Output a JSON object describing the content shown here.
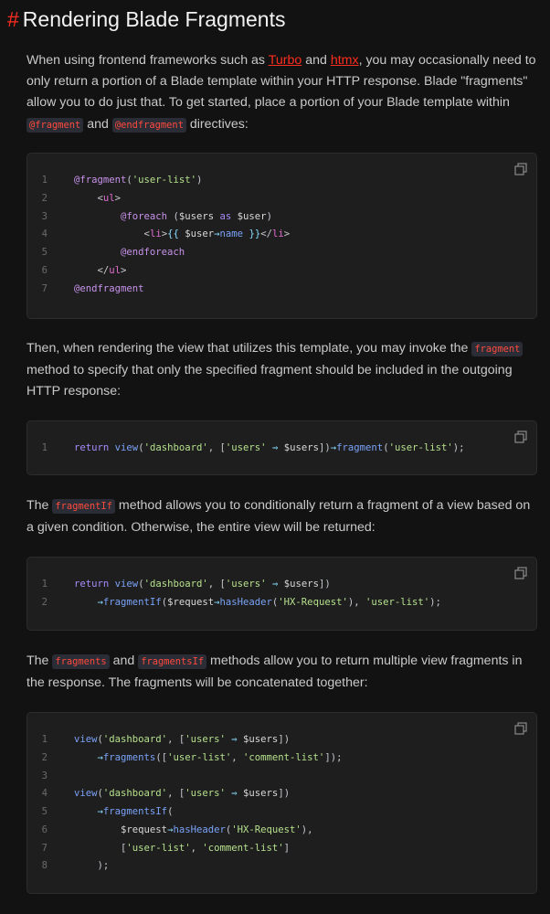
{
  "heading": {
    "hash": "#",
    "title": "Rendering Blade Fragments"
  },
  "para1": {
    "t1": "When using frontend frameworks such as ",
    "link1": "Turbo",
    "t2": " and ",
    "link2": "htmx",
    "t3": ", you may occasionally need to only return a portion of a Blade template within your HTTP response. Blade \"fragments\" allow you to do just that. To get started, place a portion of your Blade template within ",
    "code1": "@fragment",
    "t4": " and ",
    "code2": "@endfragment",
    "t5": " directives:"
  },
  "code1": {
    "lines": [
      {
        "n": "1",
        "text": "@fragment('user-list')"
      },
      {
        "n": "2",
        "text": "    <ul>"
      },
      {
        "n": "3",
        "text": "        @foreach ($users as $user)"
      },
      {
        "n": "4",
        "text": "            <li>{{ $user→name }}</li>"
      },
      {
        "n": "5",
        "text": "        @endforeach"
      },
      {
        "n": "6",
        "text": "    </ul>"
      },
      {
        "n": "7",
        "text": "@endfragment"
      }
    ]
  },
  "para2": {
    "t1": "Then, when rendering the view that utilizes this template, you may invoke the ",
    "code1": "fragment",
    "t2": " method to specify that only the specified fragment should be included in the outgoing HTTP response:"
  },
  "code2": {
    "lines": [
      {
        "n": "1",
        "text": "return view('dashboard', ['users' ⇒ $users])→fragment('user-list');"
      }
    ]
  },
  "para3": {
    "t1": "The ",
    "code1": "fragmentIf",
    "t2": " method allows you to conditionally return a fragment of a view based on a given condition. Otherwise, the entire view will be returned:"
  },
  "code3": {
    "lines": [
      {
        "n": "1",
        "text": "return view('dashboard', ['users' ⇒ $users])"
      },
      {
        "n": "2",
        "text": "    →fragmentIf($request→hasHeader('HX-Request'), 'user-list');"
      }
    ]
  },
  "para4": {
    "t1": "The ",
    "code1": "fragments",
    "t2": " and ",
    "code2": "fragmentsIf",
    "t3": " methods allow you to return multiple view fragments in the response. The fragments will be concatenated together:"
  },
  "code4": {
    "lines": [
      {
        "n": "1",
        "text": "view('dashboard', ['users' ⇒ $users])"
      },
      {
        "n": "2",
        "text": "    →fragments(['user-list', 'comment-list']);"
      },
      {
        "n": "3",
        "text": ""
      },
      {
        "n": "4",
        "text": "view('dashboard', ['users' ⇒ $users])"
      },
      {
        "n": "5",
        "text": "    →fragmentsIf("
      },
      {
        "n": "6",
        "text": "        $request→hasHeader('HX-Request'),"
      },
      {
        "n": "7",
        "text": "        ['user-list', 'comment-list']"
      },
      {
        "n": "8",
        "text": "    );"
      }
    ]
  },
  "icons": {
    "copy": "copy-icon"
  },
  "colors": {
    "accent": "#ff2d20",
    "background": "#121212",
    "code_bg": "#1e1e1e"
  }
}
